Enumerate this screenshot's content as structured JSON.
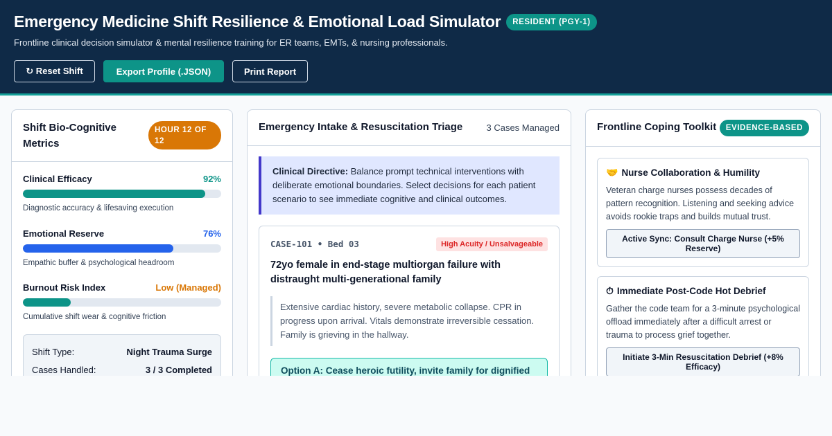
{
  "header": {
    "title": "Emergency Medicine Shift Resilience & Emotional Load Simulator",
    "badge": "RESIDENT (PGY-1)",
    "subtitle": "Frontline clinical decision simulator & mental resilience training for ER teams, EMTs, & nursing professionals.",
    "buttons": {
      "reset": "↻ Reset Shift",
      "export": "Export Profile (.JSON)",
      "print": "Print Report"
    }
  },
  "metrics_panel": {
    "title": "Shift Bio-Cognitive Metrics",
    "hour_badge": "HOUR 12 OF 12",
    "metrics": [
      {
        "label": "Clinical Efficacy",
        "value_text": "92%",
        "level": 92,
        "description": "Diagnostic accuracy & lifesaving execution",
        "color": "#0d9488"
      },
      {
        "label": "Emotional Reserve",
        "value_text": "76%",
        "level": 76,
        "description": "Empathic buffer & psychological headroom",
        "color": "#2563eb"
      },
      {
        "label": "Burnout Risk Index",
        "value_text": "Low (Managed)",
        "level": 24,
        "description": "Cumulative shift wear & cognitive friction",
        "color": "#d97706",
        "bar_color": "#0d9488"
      }
    ],
    "info": [
      {
        "label": "Shift Type:",
        "value": "Night Trauma Surge"
      },
      {
        "label": "Cases Handled:",
        "value": "3 / 3 Completed"
      }
    ]
  },
  "triage_panel": {
    "title": "Emergency Intake & Resuscitation Triage",
    "cases_count": "3 Cases Managed",
    "directive_label": "Clinical Directive:",
    "directive_text": " Balance prompt technical interventions with deliberate emotional boundaries. Select decisions for each patient scenario to see immediate cognitive and clinical outcomes.",
    "case": {
      "id": "CASE-101 • Bed 03",
      "acuity": "High Acuity / Unsalvageable",
      "title": "72yo female in end-stage multiorgan failure with distraught multi-generational family",
      "description": "Extensive cardiac history, severe metabolic collapse. CPR in progress upon arrival. Vitals demonstrate irreversible cessation. Family is grieving in the hallway.",
      "option_a": "Option A: Cease heroic futility, invite family for dignified"
    }
  },
  "toolkit_panel": {
    "title": "Frontline Coping Toolkit",
    "badge": "EVIDENCE-BASED",
    "tools": [
      {
        "icon": "🤝",
        "title": "Nurse Collaboration & Humility",
        "description": "Veteran charge nurses possess decades of pattern recognition. Listening and seeking advice avoids rookie traps and builds mutual trust.",
        "button": "Active Sync: Consult Charge Nurse (+5% Reserve)"
      },
      {
        "icon": "⏱",
        "title": "Immediate Post-Code Hot Debrief",
        "description": "Gather the code team for a 3-minute psychological offload immediately after a difficult arrest or trauma to process grief together.",
        "button": "Initiate 3-Min Resuscitation Debrief (+8% Efficacy)"
      }
    ]
  }
}
